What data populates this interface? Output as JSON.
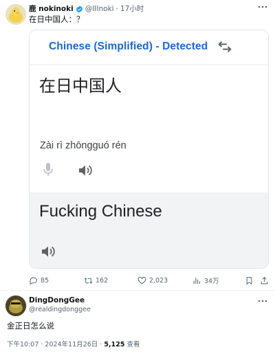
{
  "tweet": {
    "author_name": "鹿 nokinoki",
    "handle": "@IIInoki",
    "separator": "·",
    "time": "17小时",
    "text": "在日中国人：？",
    "card": {
      "detected_label": "Chinese (Simplified) - Detected",
      "source_text": "在日中国人",
      "pinyin": "Zài rì zhōngguó rén",
      "translation": "Fucking Chinese"
    },
    "actions": {
      "replies": "85",
      "retweets": "162",
      "likes": "2,023",
      "views": "34万"
    }
  },
  "reply": {
    "author_name": "DingDongGee",
    "handle": "@realdingdonggee",
    "text": "金正日怎么说",
    "footer": {
      "time": "下午10:07 · 2024年11月26日 · ",
      "views_count": "5,125",
      "views_label": " 查看"
    }
  },
  "colors": {
    "accent_blue": "#1967d2",
    "verified_blue": "#1d9bf0",
    "muted_text": "#536471"
  }
}
